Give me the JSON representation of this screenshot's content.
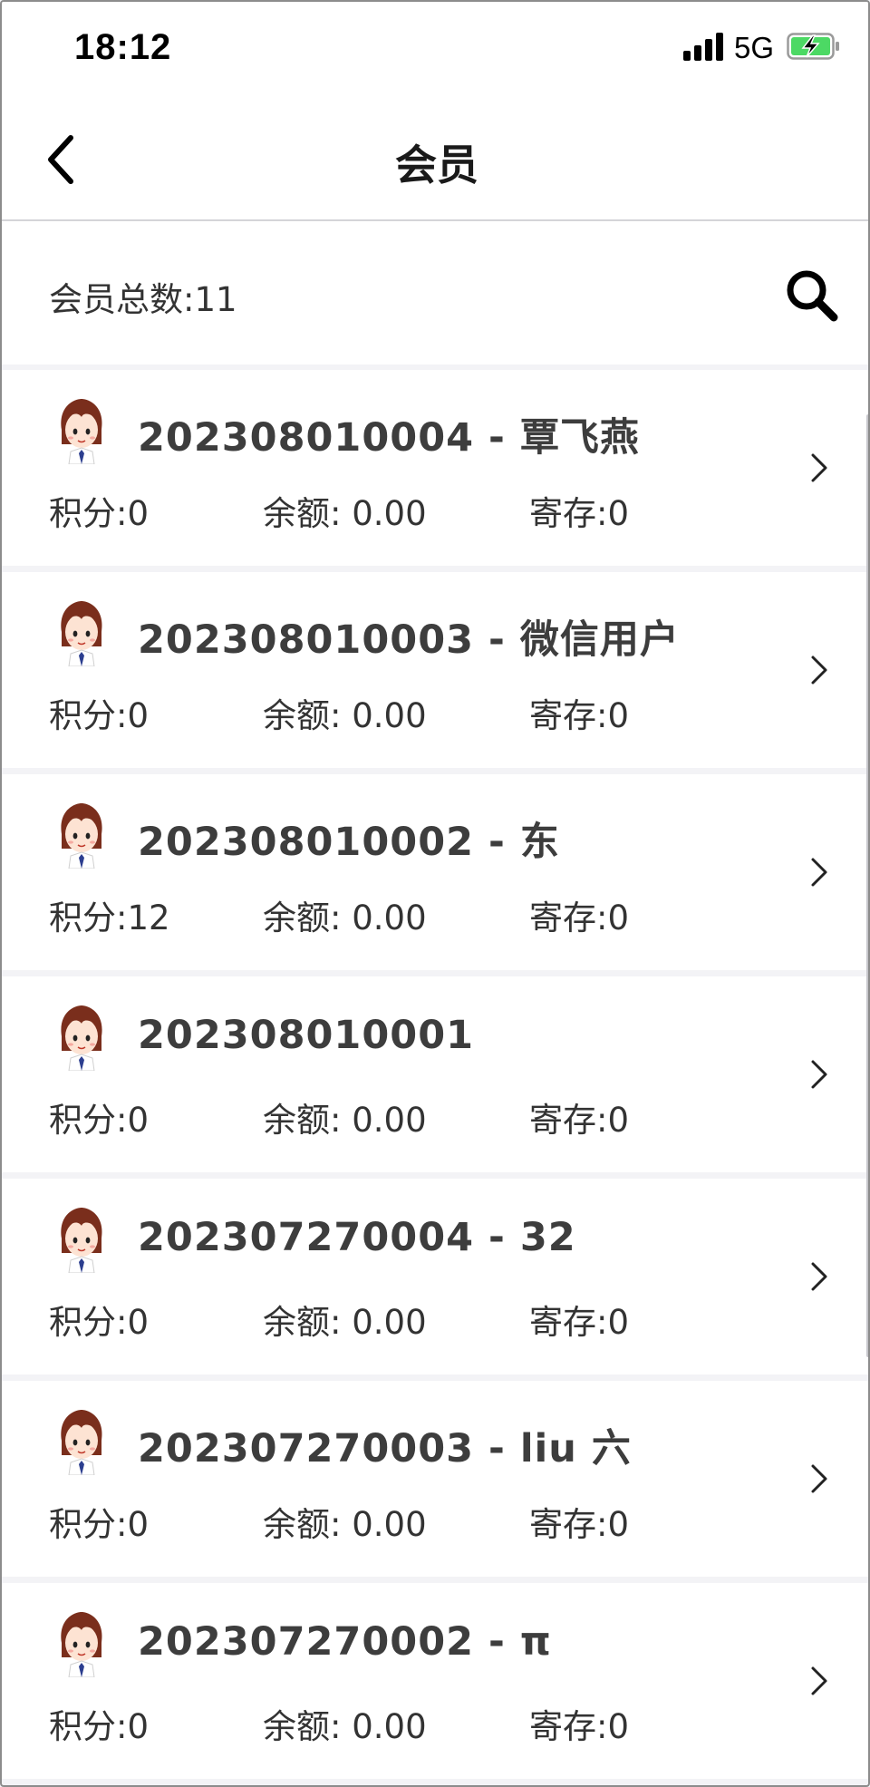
{
  "status_bar": {
    "time": "18:12",
    "network": "5G"
  },
  "nav": {
    "title": "会员"
  },
  "summary": {
    "member_count_text": "会员总数:11"
  },
  "members": [
    {
      "title": "202308010004 - 覃飞燕",
      "points": "积分:0",
      "balance": "余额: 0.00",
      "stored": "寄存:0"
    },
    {
      "title": "202308010003 - 微信用户",
      "points": "积分:0",
      "balance": "余额: 0.00",
      "stored": "寄存:0"
    },
    {
      "title": "202308010002 - 东",
      "points": "积分:12",
      "balance": "余额: 0.00",
      "stored": "寄存:0"
    },
    {
      "title": "202308010001",
      "points": "积分:0",
      "balance": "余额: 0.00",
      "stored": "寄存:0"
    },
    {
      "title": "202307270004 - 32",
      "points": "积分:0",
      "balance": "余额: 0.00",
      "stored": "寄存:0"
    },
    {
      "title": "202307270003 - liu 六",
      "points": "积分:0",
      "balance": "余额: 0.00",
      "stored": "寄存:0"
    },
    {
      "title": "202307270002 - π",
      "points": "积分:0",
      "balance": "余额: 0.00",
      "stored": "寄存:0"
    }
  ],
  "icons": {
    "back": "chevron-left-icon",
    "search": "search-icon",
    "row_arrow": "chevron-right-icon",
    "avatar": "avatar-icon",
    "signal": "signal-icon",
    "battery": "battery-charging-icon"
  },
  "colors": {
    "battery": "#4cd964",
    "background": "#f3f3f6",
    "card": "#ffffff"
  }
}
